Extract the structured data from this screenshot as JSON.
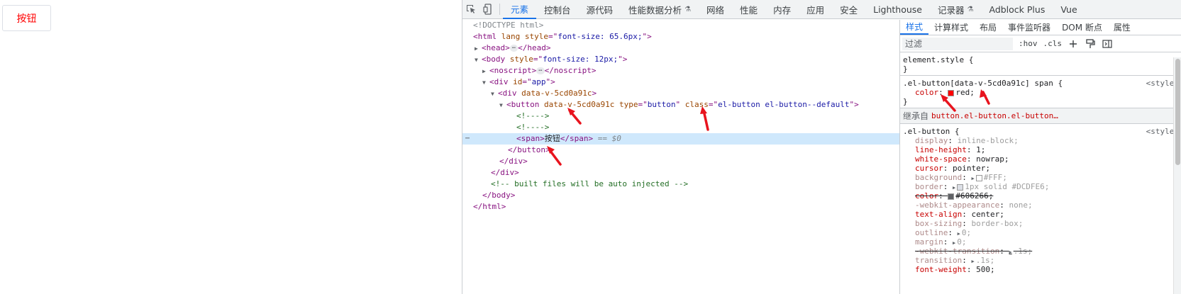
{
  "page": {
    "button_label": "按钮"
  },
  "devtools": {
    "tabs": [
      {
        "label": "元素",
        "active": true,
        "experimental": false
      },
      {
        "label": "控制台",
        "active": false,
        "experimental": false
      },
      {
        "label": "源代码",
        "active": false,
        "experimental": false
      },
      {
        "label": "性能数据分析",
        "active": false,
        "experimental": true
      },
      {
        "label": "网络",
        "active": false,
        "experimental": false
      },
      {
        "label": "性能",
        "active": false,
        "experimental": false
      },
      {
        "label": "内存",
        "active": false,
        "experimental": false
      },
      {
        "label": "应用",
        "active": false,
        "experimental": false
      },
      {
        "label": "安全",
        "active": false,
        "experimental": false
      },
      {
        "label": "Lighthouse",
        "active": false,
        "experimental": false
      },
      {
        "label": "记录器",
        "active": false,
        "experimental": true
      },
      {
        "label": "Adblock Plus",
        "active": false,
        "experimental": false
      },
      {
        "label": "Vue",
        "active": false,
        "experimental": false
      }
    ],
    "flask_glyph": "⚗",
    "dom": {
      "doctype": "<!DOCTYPE html>",
      "html_open": {
        "tag": "html",
        "attr": "lang",
        "attr2": "style",
        "val2": "font-size: 65.6px;"
      },
      "head": {
        "open": "<head>",
        "close": "</head>",
        "ellipsis": "⋯"
      },
      "body": {
        "tag": "body",
        "attr": "style",
        "val": "font-size: 12px;"
      },
      "noscript": {
        "open": "<noscript>",
        "close": "</noscript>",
        "ellipsis": "⋯"
      },
      "div_app": {
        "tag": "div",
        "attr": "id",
        "val": "app"
      },
      "div_v": {
        "tag": "div",
        "attr": "data-v-5cd0a91c"
      },
      "button": {
        "tag": "button",
        "attr1": "data-v-5cd0a91c",
        "attr2": "type",
        "val2": "button",
        "attr3": "class",
        "val3": "el-button el-button--default"
      },
      "comment1": "<!---->",
      "comment2": "<!---->",
      "span": {
        "open": "<span>",
        "text": "按钮",
        "close": "</span>",
        "marker": "== $0",
        "row_dots": "⋯"
      },
      "button_close": "</button>",
      "div_close1": "</div>",
      "div_close2": "</div>",
      "built_comment": "<!-- built files will be auto injected -->",
      "body_close": "</body>",
      "html_close": "</html>"
    },
    "styles": {
      "tabs": [
        {
          "label": "样式",
          "active": true
        },
        {
          "label": "计算样式",
          "active": false
        },
        {
          "label": "布局",
          "active": false
        },
        {
          "label": "事件监听器",
          "active": false
        },
        {
          "label": "DOM 断点",
          "active": false
        },
        {
          "label": "属性",
          "active": false
        }
      ],
      "filter_placeholder": "过滤",
      "hov": ":hov",
      "cls": ".cls",
      "element_style": {
        "selector": "element.style {",
        "close": "}"
      },
      "rule1": {
        "selector": ".el-button[data-v-5cd0a91c] span {",
        "source": "<style>",
        "prop": "color",
        "value": "red;",
        "swatch_color": "#ff0000",
        "close": "}"
      },
      "inherit": {
        "label": "继承自",
        "link": "button.el-button.el-button…"
      },
      "rule2": {
        "selector": ".el-button {",
        "source": "<style>",
        "props": [
          {
            "name": "display",
            "value": "inline-block;",
            "inherited": true,
            "strike": false,
            "arrow": false,
            "swatch": ""
          },
          {
            "name": "line-height",
            "value": "1;",
            "inherited": false,
            "strike": false,
            "arrow": false,
            "swatch": ""
          },
          {
            "name": "white-space",
            "value": "nowrap;",
            "inherited": false,
            "strike": false,
            "arrow": false,
            "swatch": ""
          },
          {
            "name": "cursor",
            "value": "pointer;",
            "inherited": false,
            "strike": false,
            "arrow": false,
            "swatch": ""
          },
          {
            "name": "background",
            "value": "#FFF;",
            "inherited": true,
            "strike": false,
            "arrow": true,
            "swatch": "#ffffff"
          },
          {
            "name": "border",
            "value": "1px solid  #DCDFE6;",
            "inherited": true,
            "strike": false,
            "arrow": true,
            "swatch": "#dcdfe6"
          },
          {
            "name": "color",
            "value": "#606266;",
            "inherited": false,
            "strike": true,
            "arrow": false,
            "swatch": "#606266"
          },
          {
            "name": "-webkit-appearance",
            "value": "none;",
            "inherited": true,
            "strike": false,
            "arrow": false,
            "swatch": ""
          },
          {
            "name": "text-align",
            "value": "center;",
            "inherited": false,
            "strike": false,
            "arrow": false,
            "swatch": ""
          },
          {
            "name": "box-sizing",
            "value": "border-box;",
            "inherited": true,
            "strike": false,
            "arrow": false,
            "swatch": ""
          },
          {
            "name": "outline",
            "value": "0;",
            "inherited": true,
            "strike": false,
            "arrow": true,
            "swatch": ""
          },
          {
            "name": "margin",
            "value": "0;",
            "inherited": true,
            "strike": false,
            "arrow": true,
            "swatch": ""
          },
          {
            "name": "-webkit-transition",
            "value": ".1s;",
            "inherited": true,
            "strike": true,
            "arrow": true,
            "swatch": ""
          },
          {
            "name": "transition",
            "value": ".1s;",
            "inherited": true,
            "strike": false,
            "arrow": true,
            "swatch": ""
          },
          {
            "name": "font-weight",
            "value": "500;",
            "inherited": false,
            "strike": false,
            "arrow": false,
            "swatch": ""
          }
        ]
      }
    }
  },
  "colors": {
    "accent": "#1a73e8",
    "annotation_arrow": "#e8141e",
    "selected_row": "#cfe8fc"
  }
}
